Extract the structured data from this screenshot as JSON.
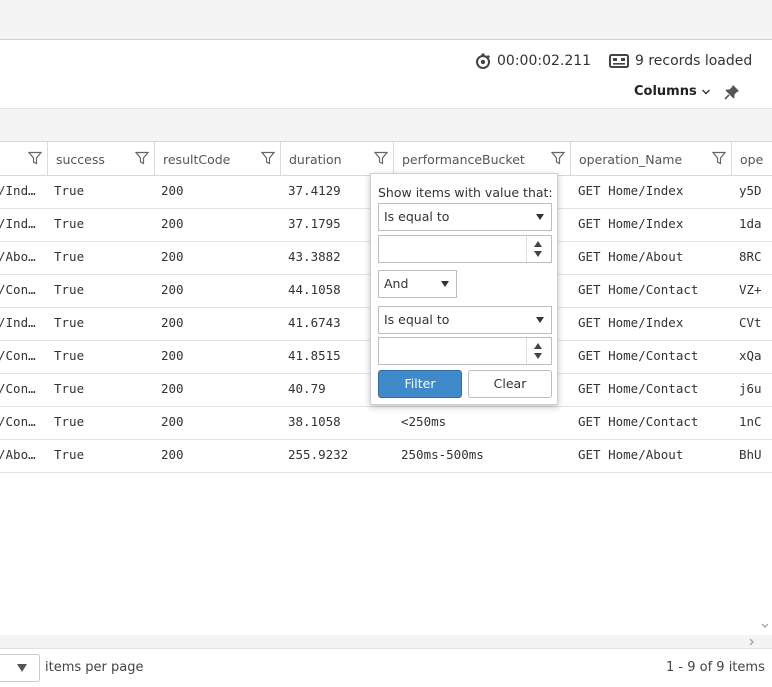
{
  "status": {
    "elapsed": "00:00:02.211",
    "records": "9 records loaded"
  },
  "toolbar": {
    "columns_label": "Columns"
  },
  "grid": {
    "headers": [
      "",
      "success",
      "resultCode",
      "duration",
      "performanceBucket",
      "operation_Name",
      "ope"
    ],
    "rows": [
      [
        "/Ind…",
        "True",
        "200",
        "37.4129",
        "",
        "GET Home/Index",
        "y5D"
      ],
      [
        "/Ind…",
        "True",
        "200",
        "37.1795",
        "",
        "GET Home/Index",
        "1da"
      ],
      [
        "/Abo…",
        "True",
        "200",
        "43.3882",
        "",
        "GET Home/About",
        "8RC"
      ],
      [
        "/Con…",
        "True",
        "200",
        "44.1058",
        "",
        "GET Home/Contact",
        "VZ+"
      ],
      [
        "/Ind…",
        "True",
        "200",
        "41.6743",
        "",
        "GET Home/Index",
        "CVt"
      ],
      [
        "/Con…",
        "True",
        "200",
        "41.8515",
        "",
        "GET Home/Contact",
        "xQa"
      ],
      [
        "/Con…",
        "True",
        "200",
        "40.79",
        "",
        "GET Home/Contact",
        "j6u"
      ],
      [
        "/Con…",
        "True",
        "200",
        "38.1058",
        "<250ms",
        "GET Home/Contact",
        "1nC"
      ],
      [
        "/Abo…",
        "True",
        "200",
        "255.9232",
        "250ms-500ms",
        "GET Home/About",
        "BhU"
      ]
    ]
  },
  "filter_popup": {
    "caption": "Show items with value that:",
    "operator1": "Is equal to",
    "value1": "",
    "logic": "And",
    "operator2": "Is equal to",
    "value2": "",
    "filter_label": "Filter",
    "clear_label": "Clear"
  },
  "footer": {
    "page_size": "",
    "items_per_page": "items per page",
    "range": "1 - 9 of 9 items"
  },
  "icons": {
    "elapsed": "stopwatch-icon",
    "records": "records-icon",
    "columns": "chevron-down-icon",
    "pin": "pin-icon",
    "filter": "filter-icon"
  },
  "colors": {
    "primary_button": "#4089ca"
  }
}
